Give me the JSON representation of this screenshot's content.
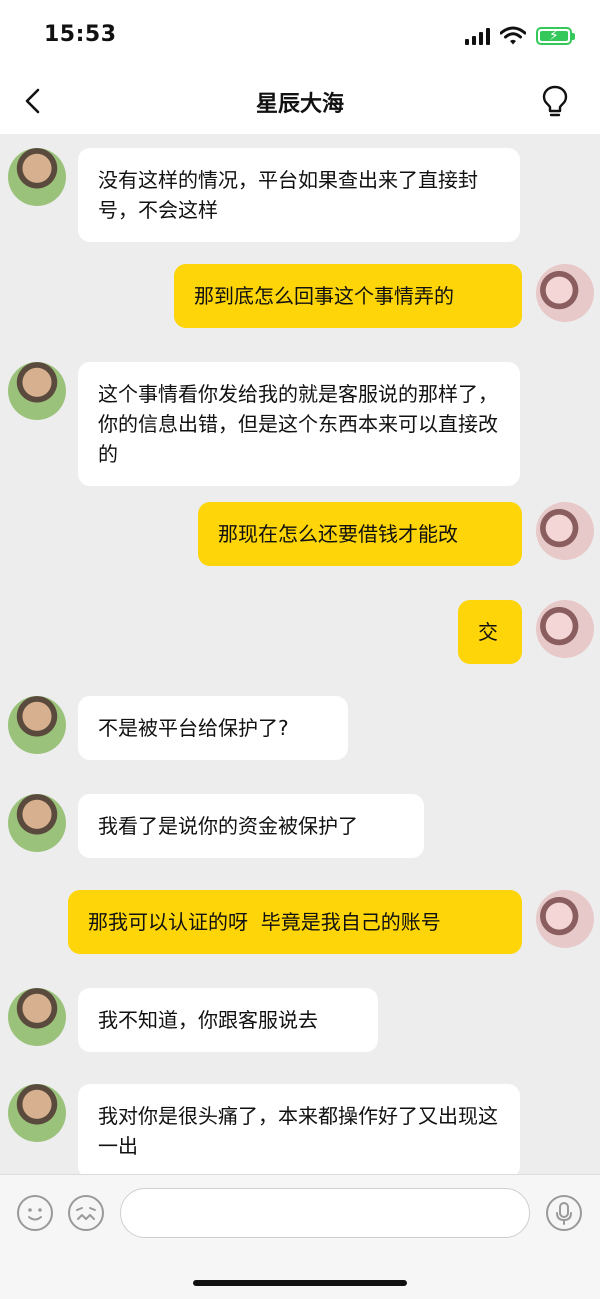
{
  "status": {
    "time": "15:53"
  },
  "nav": {
    "title": "星辰大海"
  },
  "messages": [
    {
      "side": "in",
      "text": "没有这样的情况，平台如果查出来了直接封号，不会这样"
    },
    {
      "side": "out",
      "text": "那到底怎么回事这个事情弄的"
    },
    {
      "side": "in",
      "text": "这个事情看你发给我的就是客服说的那样了，你的信息出错，但是这个东西本来可以直接改的"
    },
    {
      "side": "out",
      "text": "那现在怎么还要借钱才能改"
    },
    {
      "side": "out",
      "text": "交"
    },
    {
      "side": "in",
      "text": "不是被平台给保护了?"
    },
    {
      "side": "in",
      "text": "我看了是说你的资金被保护了"
    },
    {
      "side": "out",
      "text": "那我可以认证的呀  毕竟是我自己的账号"
    },
    {
      "side": "in",
      "text": "我不知道，你跟客服说去"
    },
    {
      "side": "in",
      "text": "我对你是很头痛了，本来都操作好了又出现这一出"
    }
  ],
  "input": {
    "placeholder": ""
  },
  "icons": {
    "back": "chevron-left-icon",
    "bulb": "lightbulb-icon",
    "emoji": "smiley-icon",
    "sticker": "sticker-icon",
    "voice": "microphone-icon"
  },
  "colors": {
    "outgoing_bubble": "#fed509",
    "incoming_bubble": "#ffffff",
    "background": "#ededed"
  }
}
